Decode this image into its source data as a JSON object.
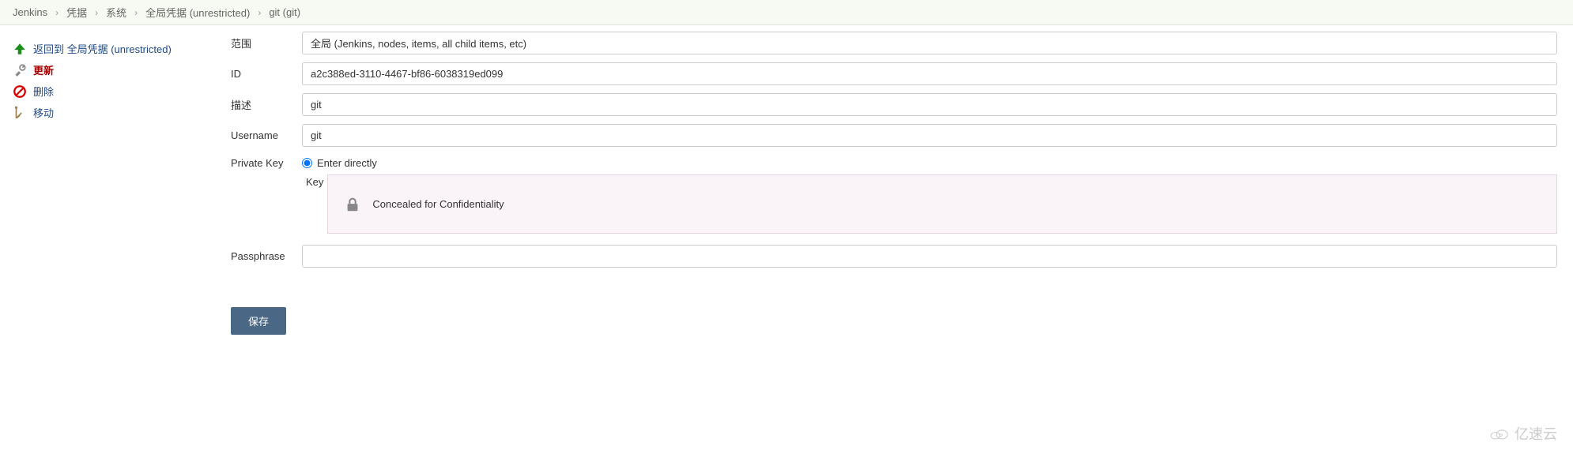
{
  "breadcrumb": {
    "items": [
      "Jenkins",
      "凭据",
      "系统",
      "全局凭据 (unrestricted)",
      "git (git)"
    ]
  },
  "sidebar": {
    "items": [
      {
        "label": "返回到 全局凭据 (unrestricted)"
      },
      {
        "label": "更新"
      },
      {
        "label": "删除"
      },
      {
        "label": "移动"
      }
    ]
  },
  "form": {
    "scope_label": "范围",
    "scope_value": "全局 (Jenkins, nodes, items, all child items, etc)",
    "id_label": "ID",
    "id_value": "a2c388ed-3110-4467-bf86-6038319ed099",
    "desc_label": "描述",
    "desc_value": "git",
    "username_label": "Username",
    "username_value": "git",
    "privatekey_label": "Private Key",
    "enter_directly_label": "Enter directly",
    "key_label": "Key",
    "concealed_text": "Concealed for Confidentiality",
    "passphrase_label": "Passphrase",
    "passphrase_value": "",
    "save_label": "保存"
  },
  "watermark": {
    "text": "亿速云"
  }
}
